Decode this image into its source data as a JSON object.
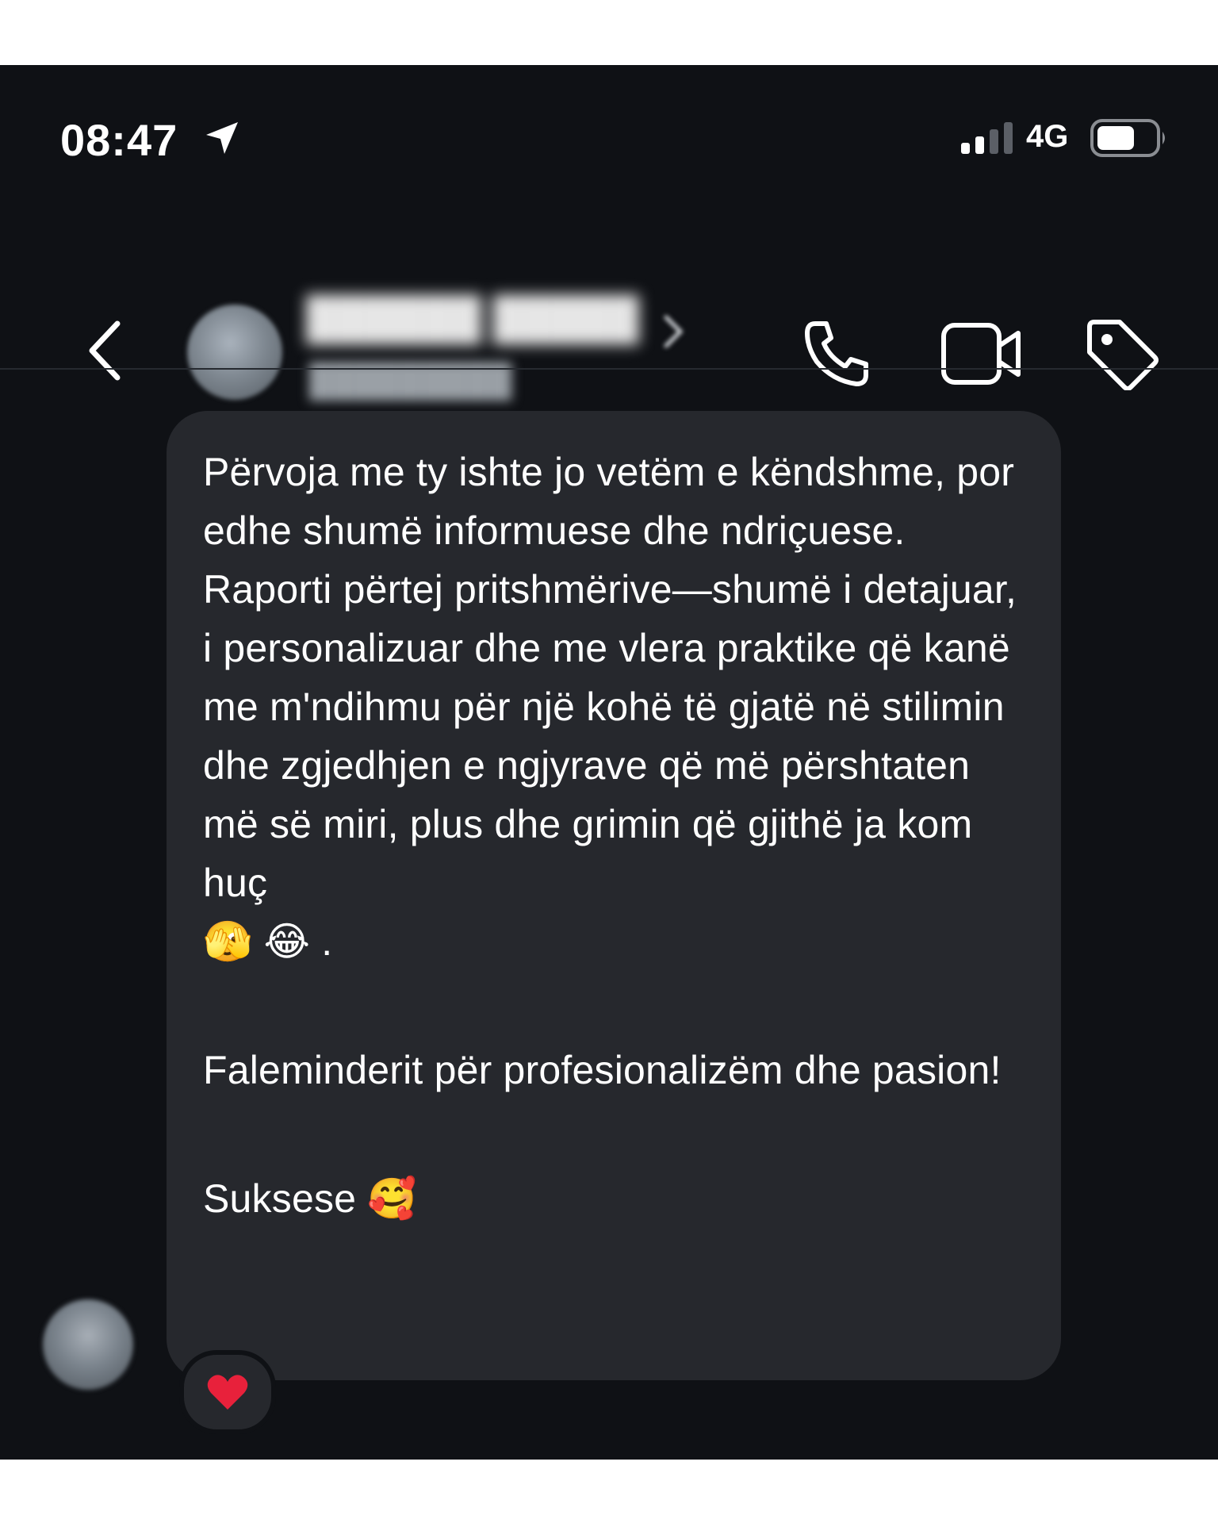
{
  "status_bar": {
    "time": "08:47",
    "network": "4G",
    "icons": [
      "location-arrow-icon",
      "signal-bars-icon",
      "battery-icon"
    ]
  },
  "header": {
    "icons": [
      "back-chevron-icon",
      "phone-icon",
      "video-camera-icon",
      "tag-icon"
    ]
  },
  "message": {
    "paragraphs": [
      "Përvoja me ty ishte jo vetëm e këndshme, por edhe shumë informuese dhe ndriçuese. Raporti përtej pritshmërive—shumë i detajuar, i personalizuar dhe me vlera praktike që kanë me m'ndihmu për një kohë të gjatë në stilimin dhe zgjedhjen e ngjyrave që më përshtaten më së miri, plus dhe grimin që gjithë ja kom huç",
      "🫣 😂 .",
      "Faleminderit për profesionalizëm dhe pasion!",
      "Suksese 🥰"
    ],
    "reaction": "❤️",
    "bubble_color": "#26282d"
  },
  "colors": {
    "background": "#0f1115",
    "text": "#ffffff",
    "reaction_heart": "#e8213b"
  }
}
